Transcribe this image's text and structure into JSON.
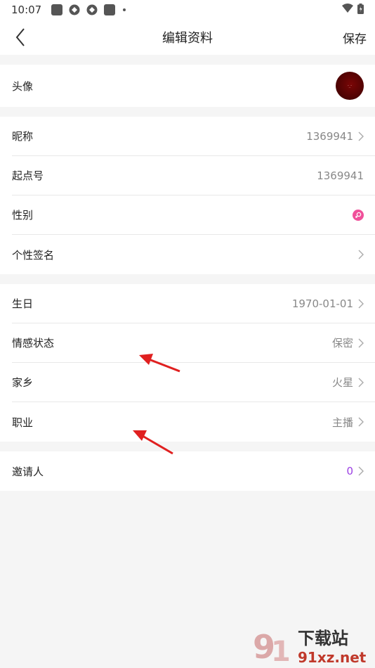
{
  "status_bar": {
    "time": "10:07"
  },
  "header": {
    "title": "编辑资料",
    "save_label": "保存"
  },
  "avatar_row": {
    "label": "头像"
  },
  "profile_rows": [
    {
      "label": "昵称",
      "value": "1369941"
    },
    {
      "label": "起点号",
      "value": "1369941"
    },
    {
      "label": "性别"
    },
    {
      "label": "个性签名"
    }
  ],
  "info_rows": [
    {
      "label": "生日",
      "value": "1970-01-01"
    },
    {
      "label": "情感状态",
      "value": "保密"
    },
    {
      "label": "家乡",
      "value": "火星"
    },
    {
      "label": "职业",
      "value": "主播"
    }
  ],
  "invite_row": {
    "label": "邀请人",
    "value": "0"
  },
  "colors": {
    "accent_purple": "#9b3fe3",
    "gender_pink": "#f0509a",
    "annotation_red": "#e02020"
  },
  "watermark": {
    "brand": "下载站",
    "domain": "91xz.net"
  }
}
